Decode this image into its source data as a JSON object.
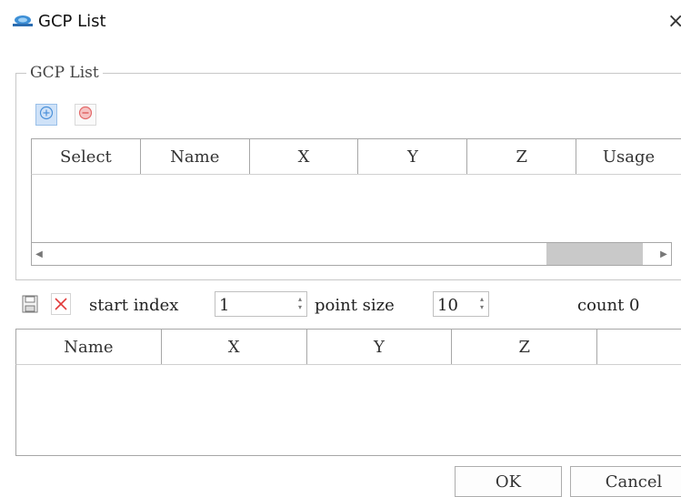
{
  "window": {
    "title": "GCP List",
    "app_icon": "logo-icon",
    "close_glyph": "×",
    "close_icon": "close-icon"
  },
  "gcp_group": {
    "legend": "GCP List",
    "add_icon": "plus-circle-icon",
    "remove_icon": "minus-circle-icon",
    "columns": [
      "Select",
      "Name",
      "X",
      "Y",
      "Z",
      "Usage"
    ],
    "rows": [],
    "scroll_left_glyph": "◀",
    "scroll_right_glyph": "▶"
  },
  "point_toolbar": {
    "save_icon": "save-icon",
    "delete_icon": "delete-x-icon",
    "start_index_label": "start index",
    "start_index_value": "1",
    "point_size_label": "point size",
    "point_size_value": "10",
    "count_label": "count 0",
    "spin_glyph": "▴▾"
  },
  "points_grid": {
    "columns": [
      "Name",
      "X",
      "Y",
      "Z",
      ""
    ],
    "rows": []
  },
  "buttons": {
    "ok": "OK",
    "cancel": "Cancel"
  },
  "colors": {
    "add_button_bg": "#cfe2f8",
    "add_icon": "#4a90d9",
    "remove_icon": "#e36a6a",
    "delete_icon": "#e23b3b",
    "scroll_thumb": "#c9c9c9",
    "border": "#a7a7a7"
  }
}
